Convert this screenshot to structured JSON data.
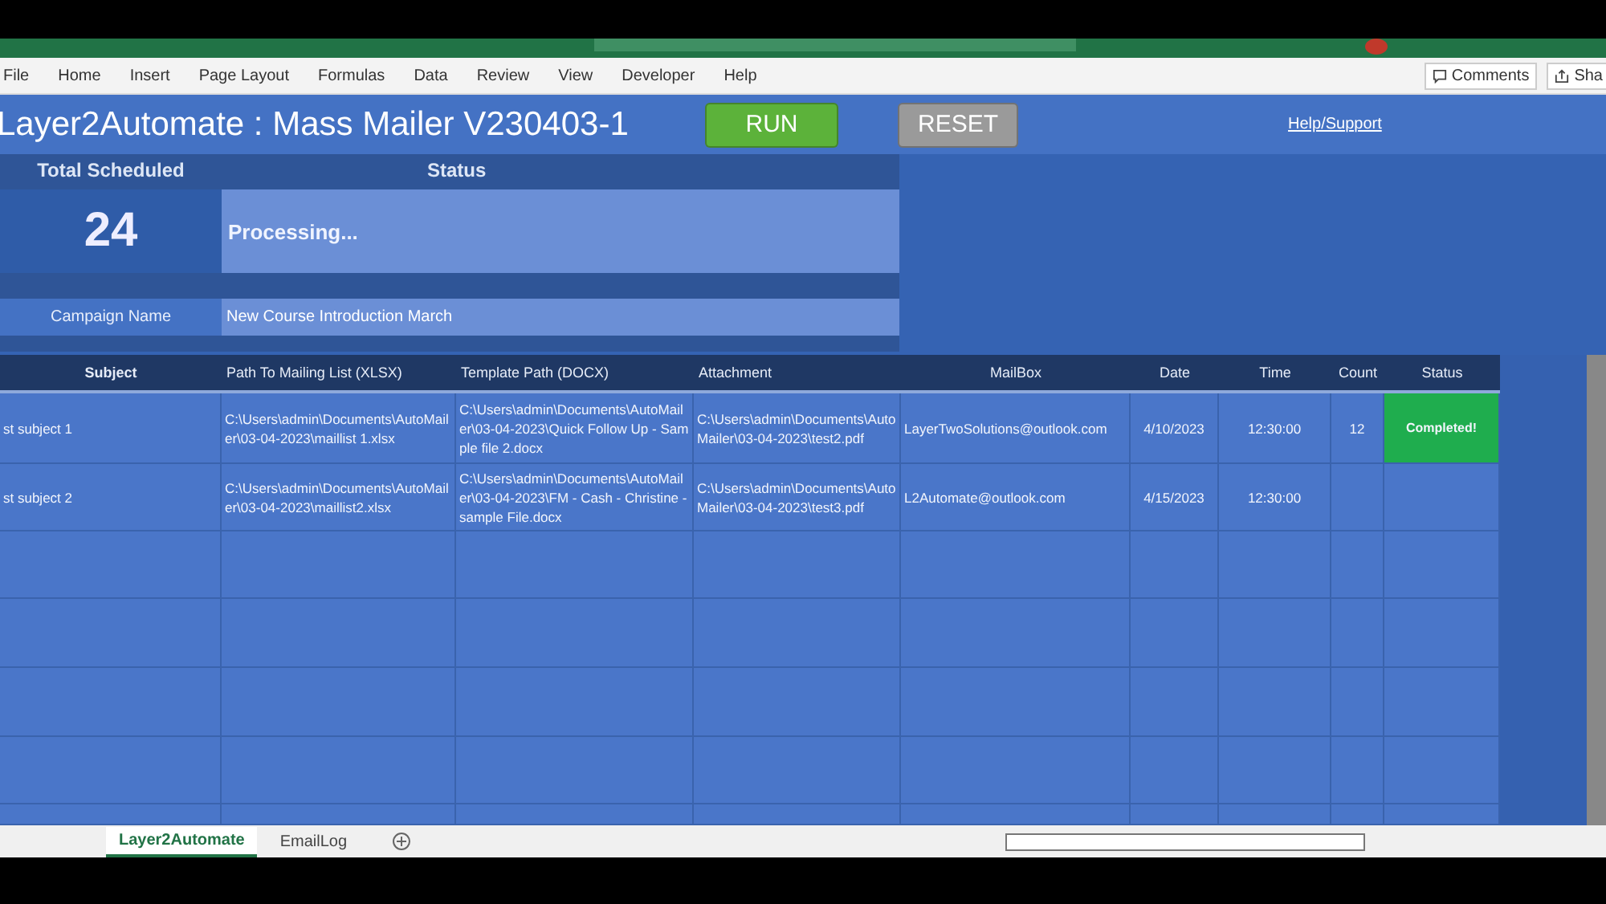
{
  "ribbon": {
    "menu": [
      "File",
      "Home",
      "Insert",
      "Page Layout",
      "Formulas",
      "Data",
      "Review",
      "View",
      "Developer",
      "Help"
    ],
    "comments": "Comments",
    "share": "Sha"
  },
  "header": {
    "title": "Layer2Automate : Mass Mailer V230403-1",
    "run": "RUN",
    "reset": "RESET",
    "help": "Help/Support"
  },
  "summary": {
    "total_label": "Total Scheduled",
    "status_label": "Status",
    "total": "24",
    "status": "Processing...",
    "campaign_label": "Campaign Name",
    "campaign": "New Course Introduction March"
  },
  "table": {
    "columns": [
      "Subject",
      "Path To Mailing List (XLSX)",
      "Template Path (DOCX)",
      "Attachment",
      "MailBox",
      "Date",
      "Time",
      "Count",
      "Status"
    ],
    "rows": [
      {
        "subject": "st subject 1",
        "mailing_list": "C:\\Users\\admin\\Documents\\AutoMailer\\03-04-2023\\maillist 1.xlsx",
        "template": "C:\\Users\\admin\\Documents\\AutoMailer\\03-04-2023\\Quick Follow Up - Sample file 2.docx",
        "attachment": "C:\\Users\\admin\\Documents\\AutoMailer\\03-04-2023\\test2.pdf",
        "mailbox": "LayerTwoSolutions@outlook.com",
        "date": "4/10/2023",
        "time": "12:30:00",
        "count": "12",
        "status": {
          "text": "Completed!",
          "kind": "completed"
        }
      },
      {
        "subject": "st subject 2",
        "mailing_list": "C:\\Users\\admin\\Documents\\AutoMailer\\03-04-2023\\maillist2.xlsx",
        "template": "C:\\Users\\admin\\Documents\\AutoMailer\\03-04-2023\\FM - Cash - Christine - sample File.docx",
        "attachment": "C:\\Users\\admin\\Documents\\AutoMailer\\03-04-2023\\test3.pdf",
        "mailbox": "L2Automate@outlook.com",
        "date": "4/15/2023",
        "time": "12:30:00"
      }
    ]
  },
  "sheet_tabs": [
    {
      "label": "Layer2Automate",
      "selected": true
    },
    {
      "label": "EmailLog",
      "selected": false
    }
  ]
}
